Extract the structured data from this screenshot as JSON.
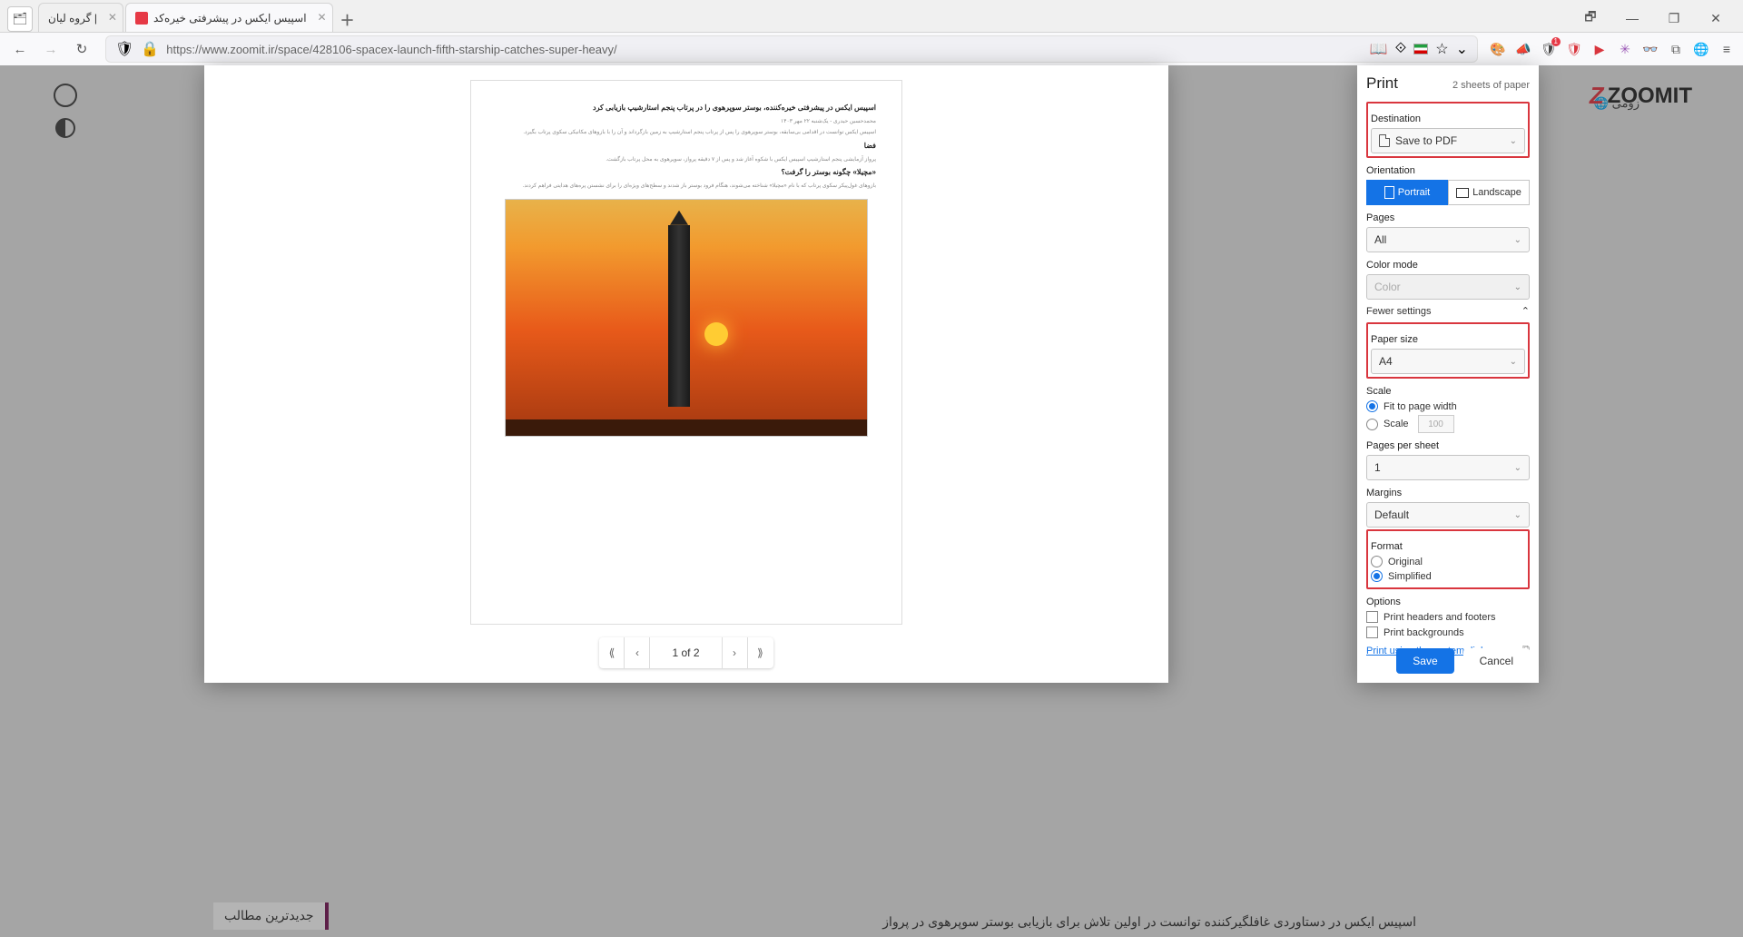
{
  "tabs": {
    "square_icon": "🗂",
    "tab1": "گروه لیان |",
    "tab2": "اسپیس ایکس در پیشرفتی خیره‌کد",
    "plus": "＋"
  },
  "win": {
    "restore1": "🗗",
    "min": "—",
    "restore2": "❐",
    "close": "✕"
  },
  "nav": {
    "back": "←",
    "fwd": "→",
    "reload": "↻",
    "shield": "🛡",
    "lock": "🔒",
    "url": "https://www.zoomit.ir/space/428106-spacex-launch-fifth-starship-catches-super-heavy/",
    "reader": "📖",
    "translate": "⟐",
    "star": "☆",
    "pocket": "⌄"
  },
  "ext_icons": [
    "🎨",
    "📣",
    "🛡",
    "🛡",
    "▶",
    "✳",
    "👓",
    "⧉",
    "🌐",
    "≡"
  ],
  "page": {
    "zoom_link": "زومی",
    "logo": "ZOOMIT",
    "latest": "جدیدترین مطالب",
    "bottom": "اسپیس ایکس در دستاوردی غافلگیرکننده توانست در اولین تلاش برای بازیابی بوستر سوپرهوی در پرواز"
  },
  "preview": {
    "title": "اسپیس ایکس در پیشرفتی خیره‌کننده، بوستر سوپرهوی را در پرتاب پنجم استارشیپ بازیابی کرد",
    "l1": "محمدحسین حیدری - یک‌شنبه ۲۲ مهر ۱۴۰۳",
    "l2": "اسپیس ایکس توانست در اقدامی بی‌سابقه، بوستر سوپرهوی را پس از پرتاب پنجم استارشیپ به زمین بازگرداند و آن را با بازوهای مکانیکی سکوی پرتاب بگیرد.",
    "h2": "فضا",
    "l3": "پرواز آزمایشی پنجم استارشیپ اسپیس ایکس با شکوه آغاز شد و پس از ۷ دقیقه پرواز، سوپرهوی به محل پرتاب بازگشت.",
    "h3": "«مچیلا» چگونه بوستر را گرفت؟",
    "l4": "بازوهای غول‌پیکر سکوی پرتاب که با نام «مچیلا» شناخته می‌شوند، هنگام فرود بوستر باز شدند و سطح‌های ویژه‌ای را برای نشستن پره‌های هدایتی فراهم کردند.",
    "pager_first": "⟪",
    "pager_prev": "‹",
    "pager_text": "1 of 2",
    "pager_next": "›",
    "pager_last": "⟫"
  },
  "panel": {
    "title": "Print",
    "sheets": "2 sheets of paper",
    "destination_lbl": "Destination",
    "destination_val": "Save to PDF",
    "orientation_lbl": "Orientation",
    "portrait": "Portrait",
    "landscape": "Landscape",
    "pages_lbl": "Pages",
    "pages_val": "All",
    "color_lbl": "Color mode",
    "color_val": "Color",
    "fewer": "Fewer settings",
    "paper_lbl": "Paper size",
    "paper_val": "A4",
    "scale_lbl": "Scale",
    "scale_fit": "Fit to page width",
    "scale_custom": "Scale",
    "scale_input": "100",
    "pps_lbl": "Pages per sheet",
    "pps_val": "1",
    "margins_lbl": "Margins",
    "margins_val": "Default",
    "format_lbl": "Format",
    "format_orig": "Original",
    "format_simp": "Simplified",
    "options_lbl": "Options",
    "opt_headers": "Print headers and footers",
    "opt_bg": "Print backgrounds",
    "system_link": "Print using the system dialog…",
    "ext": "⧉",
    "save": "Save",
    "cancel": "Cancel",
    "chev": "⌄",
    "chev_up": "⌃"
  }
}
